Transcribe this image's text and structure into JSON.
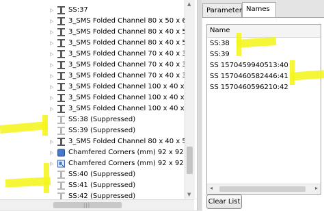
{
  "tree": {
    "items": [
      {
        "label": "SS:37",
        "icon": "ibeam-icon",
        "arrow": "▷"
      },
      {
        "label": "3_SMS Folded Channel 80 x 50 x 6 :",
        "icon": "ibeam-icon",
        "arrow": "▷"
      },
      {
        "label": "3_SMS Folded Channel 80 x 40 x 5 :",
        "icon": "ibeam-icon",
        "arrow": "▷"
      },
      {
        "label": "3_SMS Folded Channel 80 x 40 x 5 :",
        "icon": "ibeam-icon",
        "arrow": "▷"
      },
      {
        "label": "3_SMS Folded Channel 70 x 40 x 3 :",
        "icon": "ibeam-icon",
        "arrow": "▷"
      },
      {
        "label": "3_SMS Folded Channel 70 x 40 x 3 :",
        "icon": "ibeam-icon",
        "arrow": "▷"
      },
      {
        "label": "3_SMS Folded Channel 70 x 40 x 3 :",
        "icon": "ibeam-icon",
        "arrow": "▷"
      },
      {
        "label": "3_SMS Folded Channel 100 x 40 x 5",
        "icon": "ibeam-icon",
        "arrow": "▷"
      },
      {
        "label": "3_SMS Folded Channel 100 x 40 x 5",
        "icon": "ibeam-icon",
        "arrow": "▷"
      },
      {
        "label": "3_SMS Folded Channel 100 x 40 x 5",
        "icon": "ibeam-icon",
        "arrow": "▷"
      },
      {
        "label": "SS:38 (Suppressed)",
        "icon": "ibeam-suppressed-icon",
        "arrow": ""
      },
      {
        "label": "SS:39 (Suppressed)",
        "icon": "ibeam-suppressed-icon",
        "arrow": ""
      },
      {
        "label": "3_SMS Folded Channel 80 x 40 x 5 :",
        "icon": "ibeam-icon",
        "arrow": "▷"
      },
      {
        "label": "Chamfered Corners (mm) 92 x 92 x",
        "icon": "chamfer-feature-icon",
        "arrow": "▷"
      },
      {
        "label": "Chamfered Corners (mm) 92 x 92 x",
        "icon": "chamfer-part-icon",
        "arrow": "▷"
      },
      {
        "label": "SS:40 (Suppressed)",
        "icon": "ibeam-suppressed-icon",
        "arrow": ""
      },
      {
        "label": "SS:41 (Suppressed)",
        "icon": "ibeam-suppressed-icon",
        "arrow": ""
      },
      {
        "label": "SS:42 (Suppressed)",
        "icon": "ibeam-suppressed-icon",
        "arrow": ""
      }
    ]
  },
  "tabs": {
    "parameters": "Parameters",
    "names": "Names"
  },
  "names_list": {
    "header": "Name",
    "items": [
      "SS:38",
      "SS:39",
      "SS  1570459940513:40",
      "SS  1570460582446:41",
      "SS  1570460596210:42"
    ]
  },
  "buttons": {
    "clear_list": "Clear List"
  },
  "colors": {
    "highlight": "#f5f51c",
    "icon_blue": "#4a77c8",
    "tree_bg": "#ffffff"
  }
}
